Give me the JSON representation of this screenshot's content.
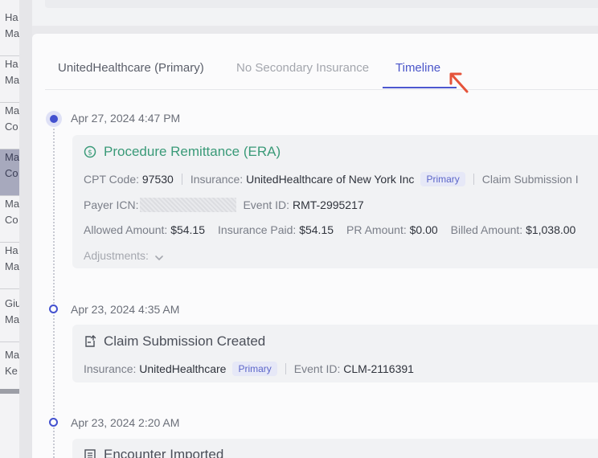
{
  "sidebar_items": [
    {
      "line1": "Ha",
      "line2": "Ma"
    },
    {
      "line1": "Ha",
      "line2": "Ma"
    },
    {
      "line1": "Ma",
      "line2": "Co"
    },
    {
      "line1": "Ma",
      "line2": "Co"
    },
    {
      "line1": "Ma",
      "line2": "Co"
    },
    {
      "line1": "Ha",
      "line2": "Ma"
    },
    {
      "line1": "Giu",
      "line2": "Ma"
    },
    {
      "line1": "Ma",
      "line2": "Ke"
    }
  ],
  "tabs": [
    {
      "label": "UnitedHealthcare (Primary)"
    },
    {
      "label": "No Secondary Insurance"
    },
    {
      "label": "Timeline"
    }
  ],
  "events": [
    {
      "date": "Apr 27, 2024 4:47 PM",
      "title": "Procedure Remittance (ERA)",
      "icon": "dollar-circle-icon",
      "cpt_label": "CPT Code:",
      "cpt_value": "97530",
      "insurance_label": "Insurance:",
      "insurance_value": "UnitedHealthcare of New York Inc",
      "badge": "Primary",
      "claim_label": "Claim Submission I",
      "payer_icn_label": "Payer ICN:",
      "event_id_label": "Event ID:",
      "event_id_value": "RMT-2995217",
      "allowed_label": "Allowed Amount:",
      "allowed_value": "$54.15",
      "insurance_paid_label": "Insurance Paid:",
      "insurance_paid_value": "$54.15",
      "pr_label": "PR Amount:",
      "pr_value": "$0.00",
      "billed_label": "Billed Amount:",
      "billed_value": "$1,038.00",
      "adjustments_label": "Adjustments:"
    },
    {
      "date": "Apr 23, 2024 4:35 AM",
      "title": "Claim Submission Created",
      "icon": "document-upload-icon",
      "insurance_label": "Insurance:",
      "insurance_value": "UnitedHealthcare",
      "badge": "Primary",
      "event_id_label": "Event ID:",
      "event_id_value": "CLM-2116391"
    },
    {
      "date": "Apr 23, 2024 2:20 AM",
      "title": "Encounter Imported",
      "icon": "list-icon"
    }
  ],
  "colors": {
    "accent": "#4c57cf",
    "success": "#3a9a78",
    "annotation_arrow": "#e5533a"
  }
}
